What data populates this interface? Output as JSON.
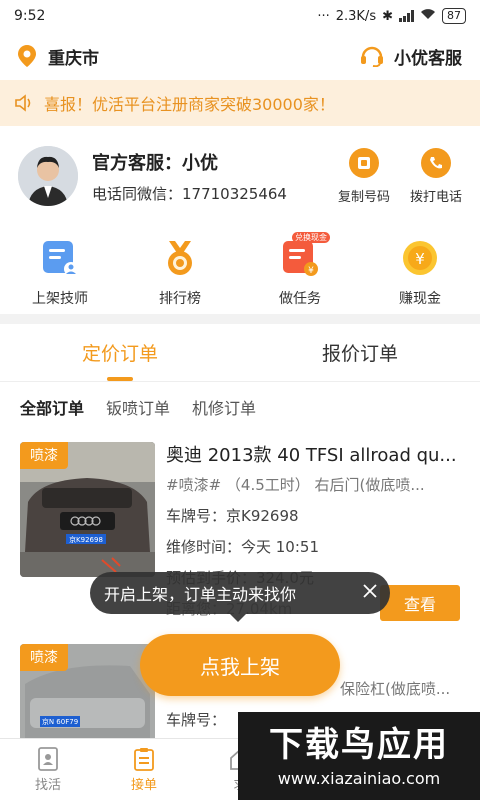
{
  "status": {
    "time": "9:52",
    "speed": "2.3K/s",
    "battery": "87"
  },
  "header": {
    "city": "重庆市",
    "service": "小优客服"
  },
  "notice": {
    "text": "喜报！优活平台注册商家突破30000家！"
  },
  "contact": {
    "name": "官方客服：小优",
    "phone": "电话同微信：17710325464",
    "copy_label": "复制号码",
    "call_label": "拨打电话"
  },
  "menu": {
    "items": [
      {
        "label": "上架技师"
      },
      {
        "label": "排行榜"
      },
      {
        "label": "做任务",
        "badge": "兑换现金"
      },
      {
        "label": "赚现金"
      }
    ]
  },
  "tabs": [
    {
      "label": "定价订单"
    },
    {
      "label": "报价订单"
    }
  ],
  "subtabs": [
    {
      "label": "全部订单"
    },
    {
      "label": "钣喷订单"
    },
    {
      "label": "机修订单"
    }
  ],
  "orders": [
    {
      "badge": "喷漆",
      "plate_image": "京K92698",
      "title": "奥迪 2013款 40 TFSI allroad qu...",
      "service": "#喷漆#  （4.5工时）  右后门(做底喷...",
      "plate": "车牌号：京K92698",
      "time": "维修时间：今天 10:51",
      "price": "预估到手价：324.0元",
      "distance": "距离您：27.04km",
      "view_label": "查看"
    },
    {
      "badge": "喷漆",
      "plate_image": "京N 60F79",
      "service": "保险杠(做底喷...",
      "plate": "车牌号："
    }
  ],
  "tooltip": {
    "text": "开启上架，订单主动来找你"
  },
  "cta": {
    "label": "点我上架"
  },
  "bottom_nav": [
    {
      "label": "找活"
    },
    {
      "label": "接单"
    },
    {
      "label": "求"
    }
  ],
  "watermark": {
    "big": "下载鸟应用",
    "small": "www.xiazainiao.com"
  },
  "colors": {
    "accent": "#f39a1d",
    "notice_bg": "#fdefdc",
    "red": "#f45b3c"
  }
}
